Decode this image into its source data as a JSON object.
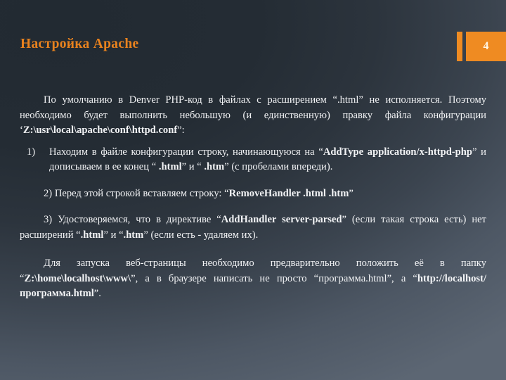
{
  "slide": {
    "title": "Настройка Apache",
    "number": "4",
    "accent_color": "#ef8b22",
    "title_color": "#e8821e",
    "text_color": "#f2f3f5",
    "background_top_color": "#232a32",
    "background_bottom_color": "#5c6673"
  },
  "body": {
    "intro": {
      "segments": [
        {
          "text": "По умолчанию в Denver PHP-код в файлах с расширением “.html” не исполняется. Поэтому необходимо будет выполнить небольшую (и единственную) правку файла конфигурации ‘",
          "bold": false
        },
        {
          "text": "Z:\\usr\\local\\apache\\conf\\httpd.conf",
          "bold": true
        },
        {
          "text": "”:",
          "bold": false
        }
      ],
      "plain": "По умолчанию в Denver PHP-код в файлах с расширением “.html” не исполняется. Поэтому необходимо будет выполнить небольшую (и единственную) правку файла конфигурации ‘Z:\\usr\\local\\apache\\conf\\httpd.conf”:"
    },
    "item1": {
      "marker": "1)",
      "part1": "Находим в файле конфигурации строку, начинающуюся на “",
      "bold1": "AddType application/x-httpd-php",
      "part2": "” и дописываем в ее конец “ ",
      "bold2": ".html",
      "part3": "” и “ ",
      "bold3": ".htm",
      "part4": "” (с пробелами впереди)."
    },
    "item2": {
      "marker": "2)",
      "part1": "Перед этой строкой вставляем строку:  “",
      "bold1": "RemoveHandler .html .htm",
      "part2": "”"
    },
    "item3": {
      "marker": "3)",
      "part1": "Удостоверяемся, что в директиве “",
      "bold1": "AddHandler server-parsed",
      "part2": "” (если такая строка есть) нет расширений “",
      "bold2": ".html",
      "part3": "” и “",
      "bold3": ".htm",
      "part4": "” (если есть - удаляем их)."
    },
    "outro": {
      "part1": "Для запуска веб-страницы необходимо предварительно положить её в папку “",
      "bold1": "Z:\\home\\localhost\\www\\",
      "part2": "”,  а в браузере написать не просто “",
      "plain2": "программа.html",
      "part3": "”,  а “",
      "bold2": "http://localhost/программа.html",
      "part4": "”."
    }
  }
}
